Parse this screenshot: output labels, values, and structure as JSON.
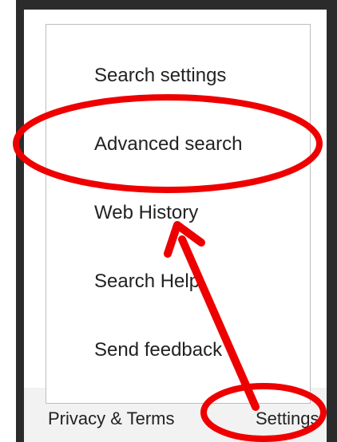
{
  "menu": {
    "items": [
      {
        "label": "Search settings"
      },
      {
        "label": "Advanced search"
      },
      {
        "label": "Web History"
      },
      {
        "label": "Search Help"
      },
      {
        "label": "Send feedback"
      }
    ]
  },
  "footer": {
    "privacy_label": "Privacy & Terms",
    "settings_label": "Settings"
  },
  "annotation": {
    "color": "#ee0000"
  }
}
